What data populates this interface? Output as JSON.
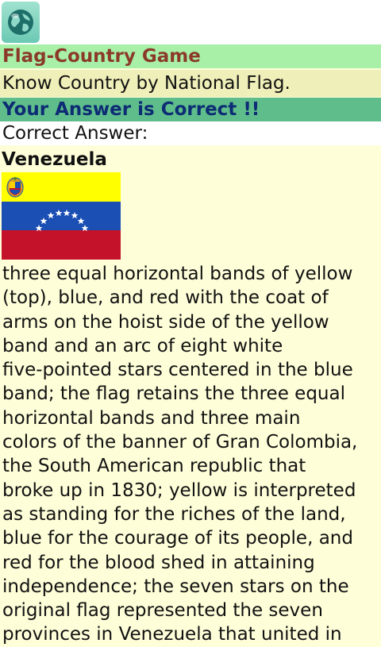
{
  "header": {
    "app_icon": "globe-icon",
    "title": "Flag-Country Game",
    "subtitle": "Know Country by National Flag."
  },
  "result": {
    "status": "Your Answer is Correct !!",
    "correct_label": "Correct Answer:"
  },
  "answer": {
    "country": "Venezuela",
    "flag_colors": {
      "yellow": "#ffff00",
      "blue": "#1b4fb4",
      "red": "#c4122b",
      "stars": "#ffffff"
    },
    "description": "three equal horizontal bands of yellow\n(top), blue, and red with the coat of\narms on the hoist side of the yellow\nband and an arc of eight white\nfive-pointed stars centered in the blue\nband; the flag retains the three equal\nhorizontal bands and three main\ncolors of the banner of Gran Colombia,\nthe South American republic that\nbroke up in 1830; yellow is interpreted\nas standing for the riches of the land,\nblue for the courage of its people, and\nred for the blood shed in attaining\nindependence; the seven stars on the\noriginal flag represented the seven\nprovinces in Venezuela that united in"
  },
  "colors": {
    "title_bg": "#a8f0a8",
    "title_text": "#8b3a2a",
    "subtitle_bg": "#efefb9",
    "result_bg": "#5fbd8b",
    "result_text": "#0d2c74",
    "page_bg": "#fefed9"
  }
}
